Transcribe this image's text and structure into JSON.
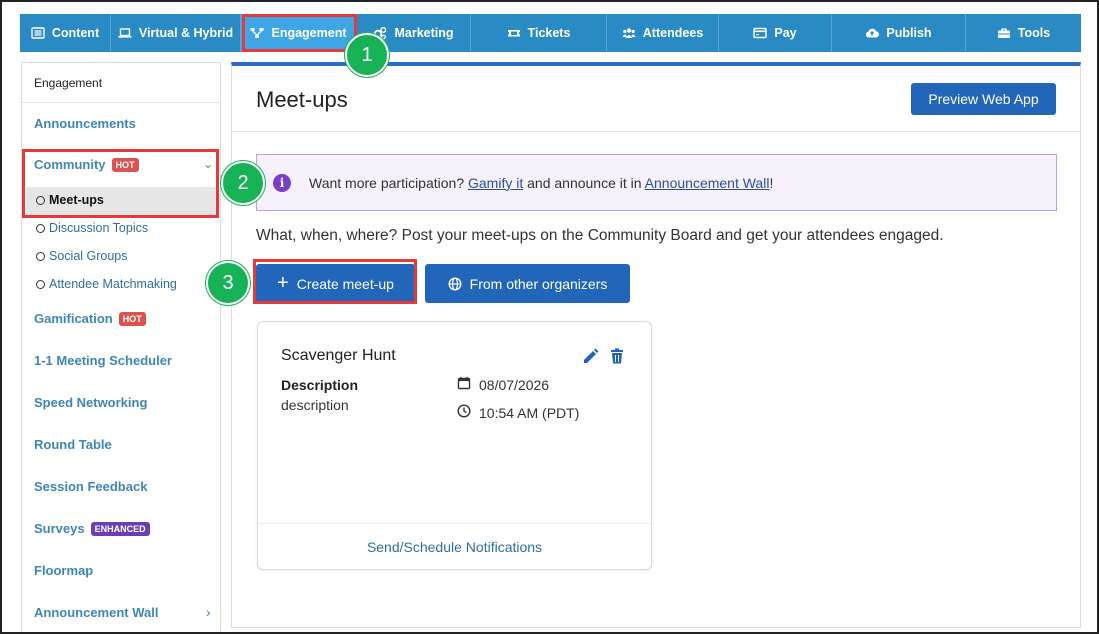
{
  "nav": {
    "items": [
      {
        "label": "Content",
        "icon": "list-icon"
      },
      {
        "label": "Virtual & Hybrid",
        "icon": "laptop-icon"
      },
      {
        "label": "Engagement",
        "icon": "network-icon"
      },
      {
        "label": "Marketing",
        "icon": "cogs-icon"
      },
      {
        "label": "Tickets",
        "icon": "ticket-icon"
      },
      {
        "label": "Attendees",
        "icon": "users-icon"
      },
      {
        "label": "Pay",
        "icon": "credit-card-icon"
      },
      {
        "label": "Publish",
        "icon": "cloud-upload-icon"
      },
      {
        "label": "Tools",
        "icon": "toolbox-icon"
      }
    ],
    "active": "Engagement"
  },
  "steps": [
    "1",
    "2",
    "3"
  ],
  "sidebar": {
    "header": "Engagement",
    "items": {
      "announcements": "Announcements",
      "community": "Community",
      "community_badge": "HOT",
      "meetups": "Meet-ups",
      "discussion": "Discussion Topics",
      "social": "Social Groups",
      "matchmaking": "Attendee Matchmaking",
      "gamification": "Gamification",
      "gamification_badge": "HOT",
      "scheduler": "1-1 Meeting Scheduler",
      "speed": "Speed Networking",
      "round": "Round Table",
      "feedback": "Session Feedback",
      "surveys": "Surveys",
      "surveys_badge": "ENHANCED",
      "floormap": "Floormap",
      "wall": "Announcement Wall"
    }
  },
  "main": {
    "title": "Meet-ups",
    "preview_button": "Preview Web App",
    "info": {
      "prefix": "Want more participation? ",
      "link1": "Gamify it",
      "middle": " and announce it in ",
      "link2": "Announcement Wall",
      "suffix": "!"
    },
    "description": "What, when, where? Post your meet-ups on the Community Board and get your attendees engaged.",
    "create_button": "Create meet-up",
    "other_button": "From other organizers"
  },
  "card": {
    "title": "Scavenger Hunt",
    "desc_label": "Description",
    "desc_value": "description",
    "date": "08/07/2026",
    "time": "10:54 AM (PDT)",
    "footer": "Send/Schedule Notifications"
  },
  "colors": {
    "nav_bg": "#2a8ac4",
    "nav_active": "#3fa6e6",
    "primary": "#2166b8",
    "highlight": "#e53a3a",
    "step": "#18b256",
    "hot": "#d9534f",
    "enhanced": "#6a3fb5"
  }
}
